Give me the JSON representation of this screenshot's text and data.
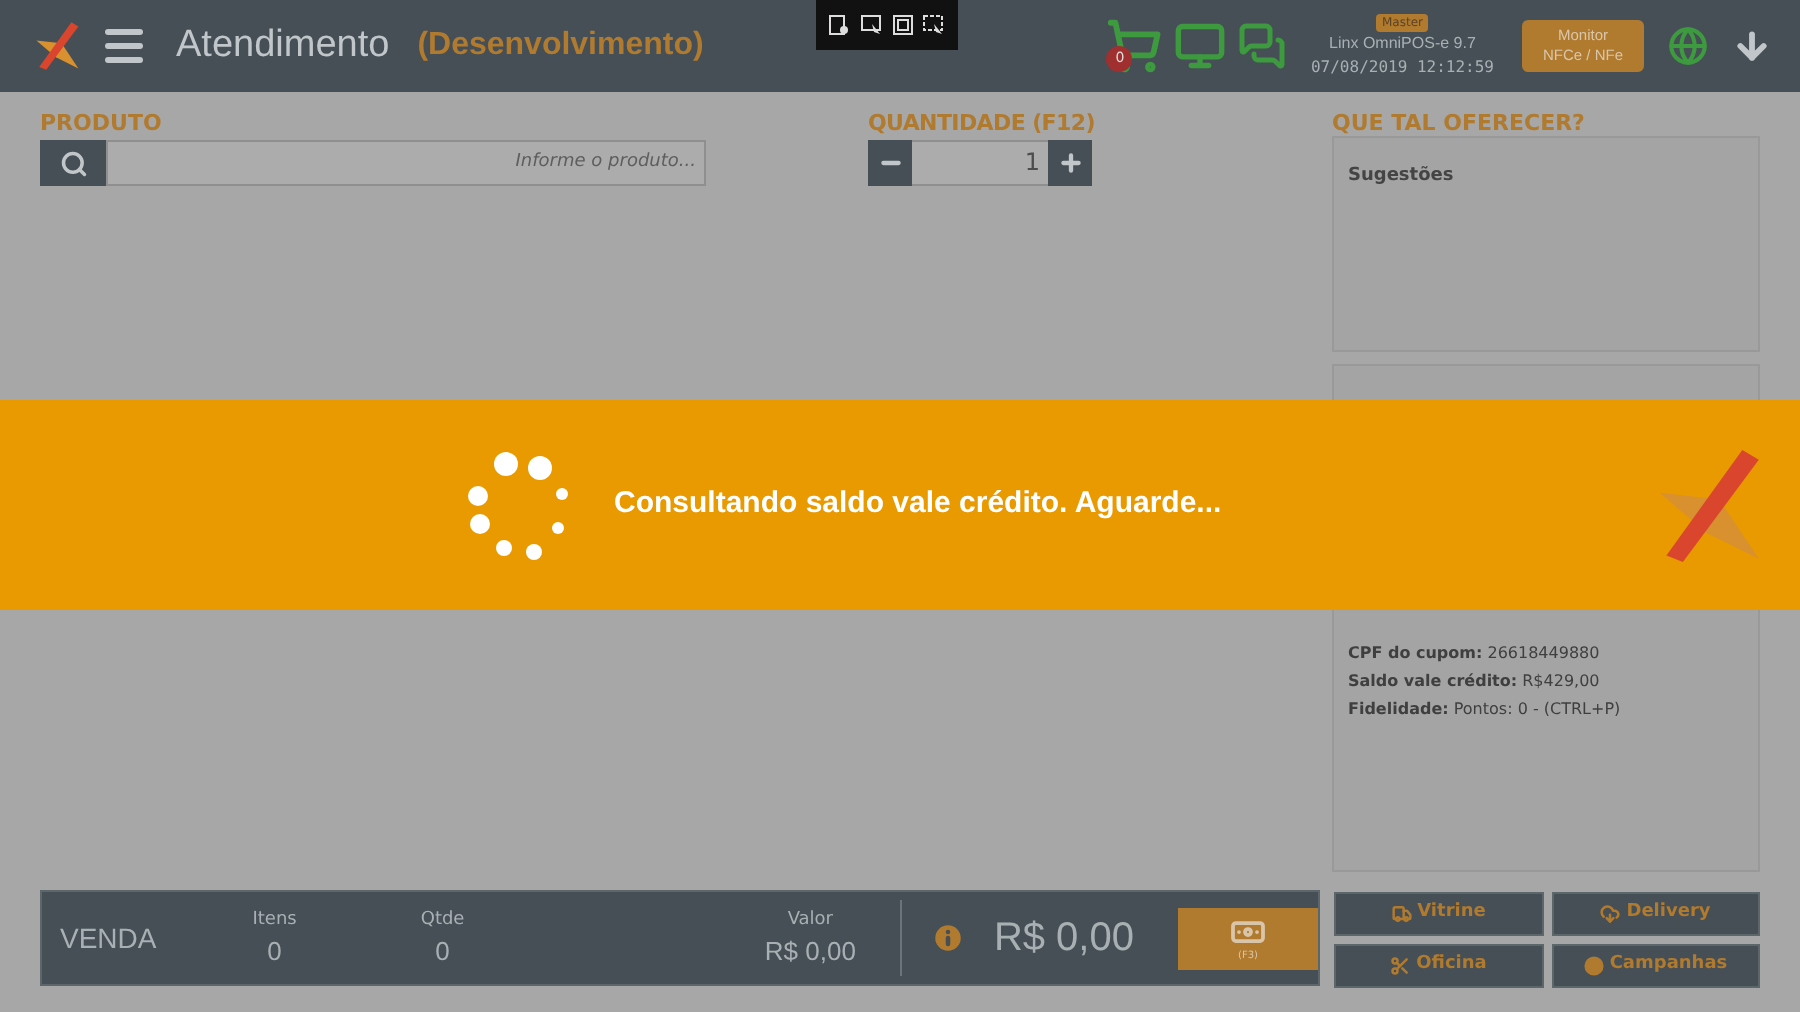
{
  "header": {
    "title": "Atendimento",
    "environment": "(Desenvolvimento)",
    "badge": "Master",
    "app_version": "Linx OmniPOS-e  9.7",
    "datetime": "07/08/2019 12:12:59",
    "cart_count": "0",
    "monitor_button": "Monitor\nNFCe / NFe"
  },
  "product": {
    "label": "PRODUTO",
    "placeholder": "Informe o produto..."
  },
  "quantity": {
    "label": "QUANTIDADE (F12)",
    "value": "1"
  },
  "suggestions": {
    "title": "QUE TAL OFERECER?",
    "box_title": "Sugestões"
  },
  "customer_info": [
    {
      "label": "CPF do cupom:",
      "value": "26618449880"
    },
    {
      "label": "Saldo vale crédito:",
      "value": "R$429,00"
    },
    {
      "label": "Fidelidade:",
      "value": "Pontos: 0 - (CTRL+P)"
    }
  ],
  "sale_bar": {
    "title": "VENDA",
    "stats": [
      {
        "label": "Itens",
        "value": "0"
      },
      {
        "label": "Qtde",
        "value": "0"
      },
      {
        "label": "Valor",
        "value": "R$ 0,00"
      }
    ],
    "total": "R$ 0,00",
    "pay_key": "(F3)"
  },
  "actions": [
    {
      "kind": "truck",
      "label": "Vitrine"
    },
    {
      "kind": "cloud",
      "label": "Delivery"
    },
    {
      "kind": "scissors",
      "label": "Oficina"
    },
    {
      "kind": "circle",
      "label": "Campanhas"
    }
  ],
  "loading": {
    "message": "Consultando saldo vale crédito. Aguarde..."
  }
}
